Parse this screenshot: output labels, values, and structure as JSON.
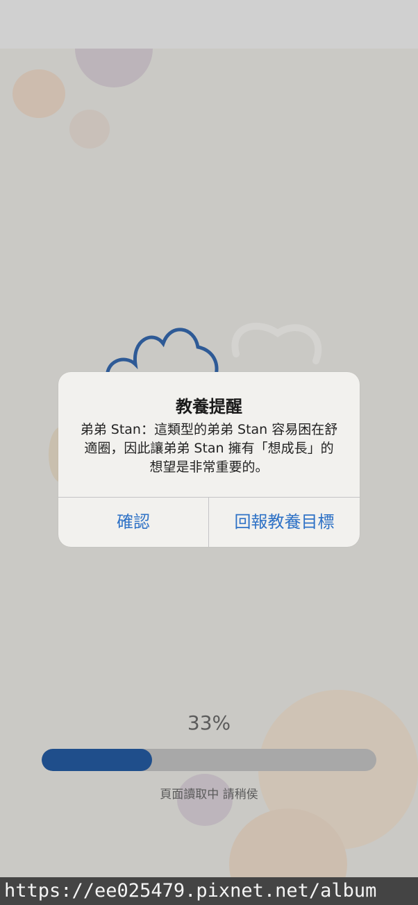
{
  "dialog": {
    "title": "教養提醒",
    "message": "弟弟 Stan：這類型的弟弟 Stan 容易困在舒適圈，因此讓弟弟 Stan 擁有「想成長」的想望是非常重要的。",
    "buttons": {
      "confirm": "確認",
      "report": "回報教養目標"
    }
  },
  "loading": {
    "percent_text": "33%",
    "progress": 0.33,
    "status_text": "頁面讀取中 請稍侯"
  },
  "watermark": {
    "text": "https://ee025479.pixnet.net/album"
  },
  "colors": {
    "accent": "#2f72c6",
    "progress_fill": "#1f4e8b",
    "progress_track": "#a8a8a8",
    "background": "#cac9c5",
    "dialog_bg": "#f2f1ee"
  }
}
